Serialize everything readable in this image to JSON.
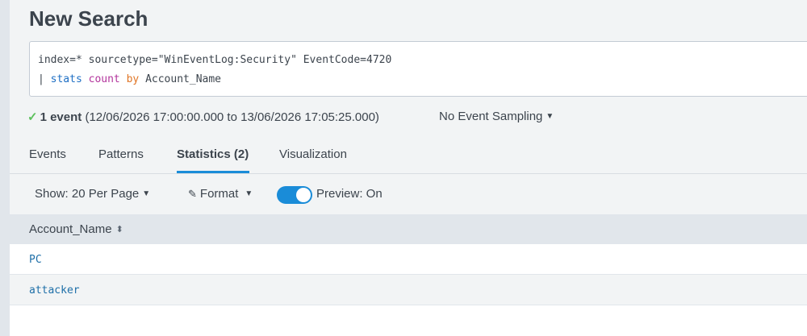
{
  "page_title": "New Search",
  "query": {
    "line1": "index=* sourcetype=\"WinEventLog:Security\" EventCode=4720",
    "line2_pipe": "| ",
    "line2_cmd": "stats",
    "line2_fn": "count",
    "line2_kw": "by",
    "line2_arg": "Account_Name"
  },
  "status": {
    "count_label": "1 event",
    "range": " (12/06/2026 17:00:00.000 to 13/06/2026 17:05:25.000)",
    "sampling": "No Event Sampling"
  },
  "tabs": [
    {
      "label": "Events"
    },
    {
      "label": "Patterns"
    },
    {
      "label": "Statistics (2)"
    },
    {
      "label": "Visualization"
    }
  ],
  "toolbar": {
    "show_label": "Show: 20 Per Page",
    "format_label": "Format",
    "preview_label": "Preview: On",
    "preview_on": true
  },
  "table": {
    "column": "Account_Name",
    "rows": [
      "PC",
      "attacker"
    ]
  },
  "colors": {
    "accent": "#1a8cd8",
    "cmd": "#1e6fc4",
    "function": "#b3349c",
    "keyword": "#e07525",
    "link": "#1e6fa8"
  },
  "icons": {
    "check": "check-icon",
    "caret": "caret-down-icon",
    "format": "pencil-icon",
    "sort": "sort-icon"
  }
}
